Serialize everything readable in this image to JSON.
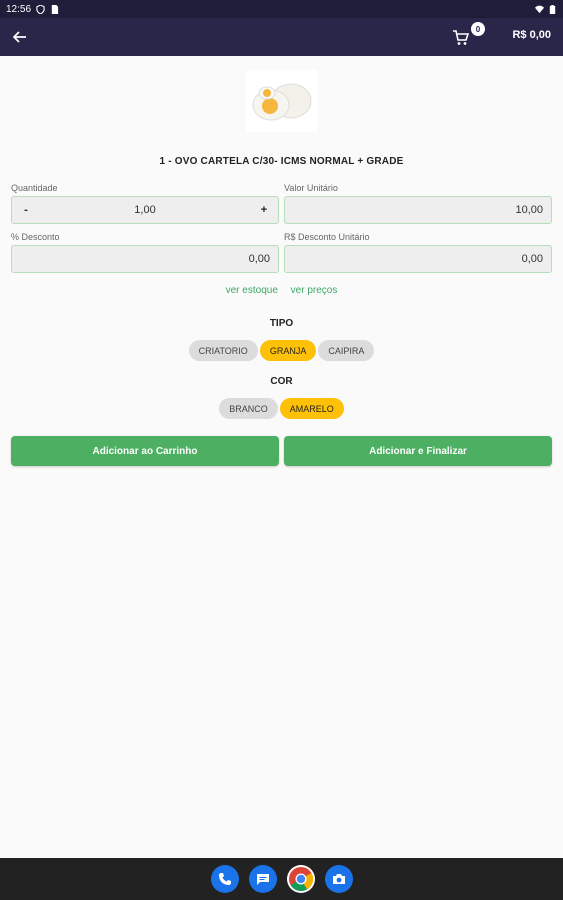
{
  "status_bar": {
    "time": "12:56"
  },
  "app_bar": {
    "cart_count": "0",
    "cart_total": "R$ 0,00"
  },
  "product": {
    "title": "1 - OVO CARTELA C/30- ICMS NORMAL + GRADE"
  },
  "fields": {
    "quantity": {
      "label": "Quantidade",
      "value": "1,00",
      "minus": "-",
      "plus": "+"
    },
    "unit_value": {
      "label": "Valor Unitário",
      "value": "10,00"
    },
    "discount_pct": {
      "label": "% Desconto",
      "value": "0,00"
    },
    "discount_unit": {
      "label": "R$ Desconto Unitário",
      "value": "0,00"
    }
  },
  "links": {
    "stock": "ver estoque",
    "prices": "ver preços"
  },
  "tipo": {
    "title": "TIPO",
    "options": [
      "CRIATORIO",
      "GRANJA",
      "CAIPIRA"
    ],
    "selected": "GRANJA"
  },
  "cor": {
    "title": "COR",
    "options": [
      "BRANCO",
      "AMARELO"
    ],
    "selected": "AMARELO"
  },
  "actions": {
    "add_to_cart": "Adicionar ao Carrinho",
    "add_and_finish": "Adicionar e Finalizar"
  },
  "colors": {
    "app_bar": "#29264a",
    "accent_green": "#4caf61",
    "chip_selected": "#ffc107"
  },
  "icons": [
    "back-arrow-icon",
    "cart-icon",
    "phone-icon",
    "messages-icon",
    "chrome-icon",
    "camera-icon"
  ]
}
